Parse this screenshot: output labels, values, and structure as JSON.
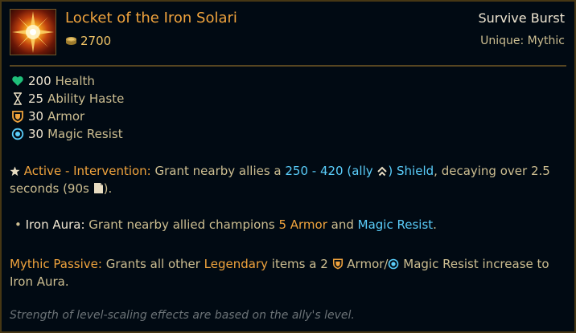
{
  "item": {
    "name": "Locket of the Iron Solari",
    "cost": "2700",
    "category": "Survive Burst",
    "rarity": "Unique: Mythic"
  },
  "stats": [
    {
      "value": "200",
      "label": "Health",
      "icon": "heart-icon"
    },
    {
      "value": "25",
      "label": "Ability Haste",
      "icon": "hourglass-icon"
    },
    {
      "value": "30",
      "label": "Armor",
      "icon": "shield-icon"
    },
    {
      "value": "30",
      "label": "Magic Resist",
      "icon": "magic-resist-icon"
    }
  ],
  "active": {
    "title": "Active - Intervention:",
    "text1": " Grant nearby allies a ",
    "amount": "250 - 420 (ally ",
    "amount_end": ")",
    "shield": " Shield",
    "text2": ", decaying over 2.5",
    "line2": "seconds (90s ",
    "line2_end": ")."
  },
  "aura": {
    "bullet": "• ",
    "name": "Iron Aura:",
    "text1": " Grant nearby allied champions ",
    "armor": "5 Armor",
    "and": " and ",
    "mr": "Magic Resist",
    "end": "."
  },
  "mythic": {
    "title": "Mythic Passive:",
    "text1": " Grants all other ",
    "legendary": "Legendary",
    "text2": " items a 2 ",
    "armor": " Armor/",
    "mr": " Magic Resist increase to",
    "line2": "Iron Aura."
  },
  "footnote": "Strength of level-scaling effects are based on the ally's level.",
  "colors": {
    "name": "#f0a33d",
    "highlight_blue": "#5acdfa",
    "border": "#463714",
    "background": "#010a13"
  }
}
